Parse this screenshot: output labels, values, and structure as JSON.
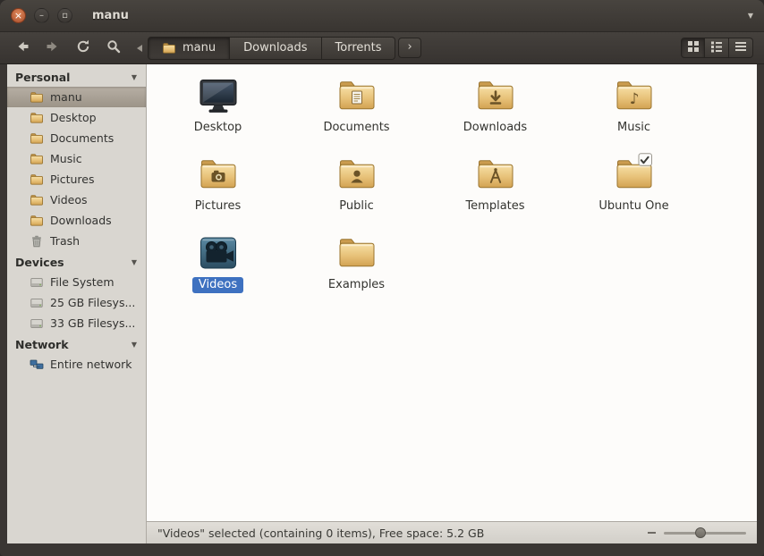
{
  "window": {
    "title": "manu",
    "controls": {
      "close": "×",
      "minimize": "–",
      "maximize": "▫",
      "menu": "▼"
    }
  },
  "toolbar": {
    "nav": [
      {
        "name": "back"
      },
      {
        "name": "forward"
      },
      {
        "name": "refresh"
      },
      {
        "name": "search"
      }
    ],
    "breadcrumbs": [
      {
        "label": "manu",
        "icon": "folder",
        "active": true
      },
      {
        "label": "Downloads"
      },
      {
        "label": "Torrents"
      }
    ],
    "breadcrumb_next": "›",
    "view_buttons": [
      {
        "name": "icon-view",
        "active": true
      },
      {
        "name": "list-view"
      },
      {
        "name": "compact-view"
      }
    ]
  },
  "sidebar": {
    "sections": [
      {
        "label": "Personal",
        "items": [
          {
            "label": "manu",
            "icon": "folder",
            "selected": true
          },
          {
            "label": "Desktop",
            "icon": "folder"
          },
          {
            "label": "Documents",
            "icon": "folder"
          },
          {
            "label": "Music",
            "icon": "folder"
          },
          {
            "label": "Pictures",
            "icon": "folder"
          },
          {
            "label": "Videos",
            "icon": "folder"
          },
          {
            "label": "Downloads",
            "icon": "folder"
          },
          {
            "label": "Trash",
            "icon": "trash"
          }
        ]
      },
      {
        "label": "Devices",
        "items": [
          {
            "label": "File System",
            "icon": "drive"
          },
          {
            "label": "25 GB Filesys...",
            "icon": "drive"
          },
          {
            "label": "33 GB Filesys...",
            "icon": "drive"
          }
        ]
      },
      {
        "label": "Network",
        "items": [
          {
            "label": "Entire network",
            "icon": "network"
          }
        ]
      }
    ]
  },
  "files": [
    {
      "label": "Desktop",
      "icon": "desktop"
    },
    {
      "label": "Documents",
      "icon": "folder",
      "emblem": "document"
    },
    {
      "label": "Downloads",
      "icon": "folder",
      "emblem": "download"
    },
    {
      "label": "Music",
      "icon": "folder",
      "emblem": "music"
    },
    {
      "label": "Pictures",
      "icon": "folder",
      "emblem": "camera"
    },
    {
      "label": "Public",
      "icon": "folder",
      "emblem": "person"
    },
    {
      "label": "Templates",
      "icon": "folder",
      "emblem": "compass"
    },
    {
      "label": "Ubuntu One",
      "icon": "folder",
      "badge": "check"
    },
    {
      "label": "Videos",
      "icon": "video",
      "selected": true
    },
    {
      "label": "Examples",
      "icon": "folder"
    }
  ],
  "statusbar": {
    "text": "\"Videos\" selected (containing 0 items), Free space: 5.2 GB"
  },
  "colors": {
    "titlebar": "#3c3836",
    "sidebar_bg": "#d9d6d0",
    "selection_blue": "#3e71c0",
    "folder_tan": "#e3b96d",
    "main_bg": "#fdfcfa"
  }
}
